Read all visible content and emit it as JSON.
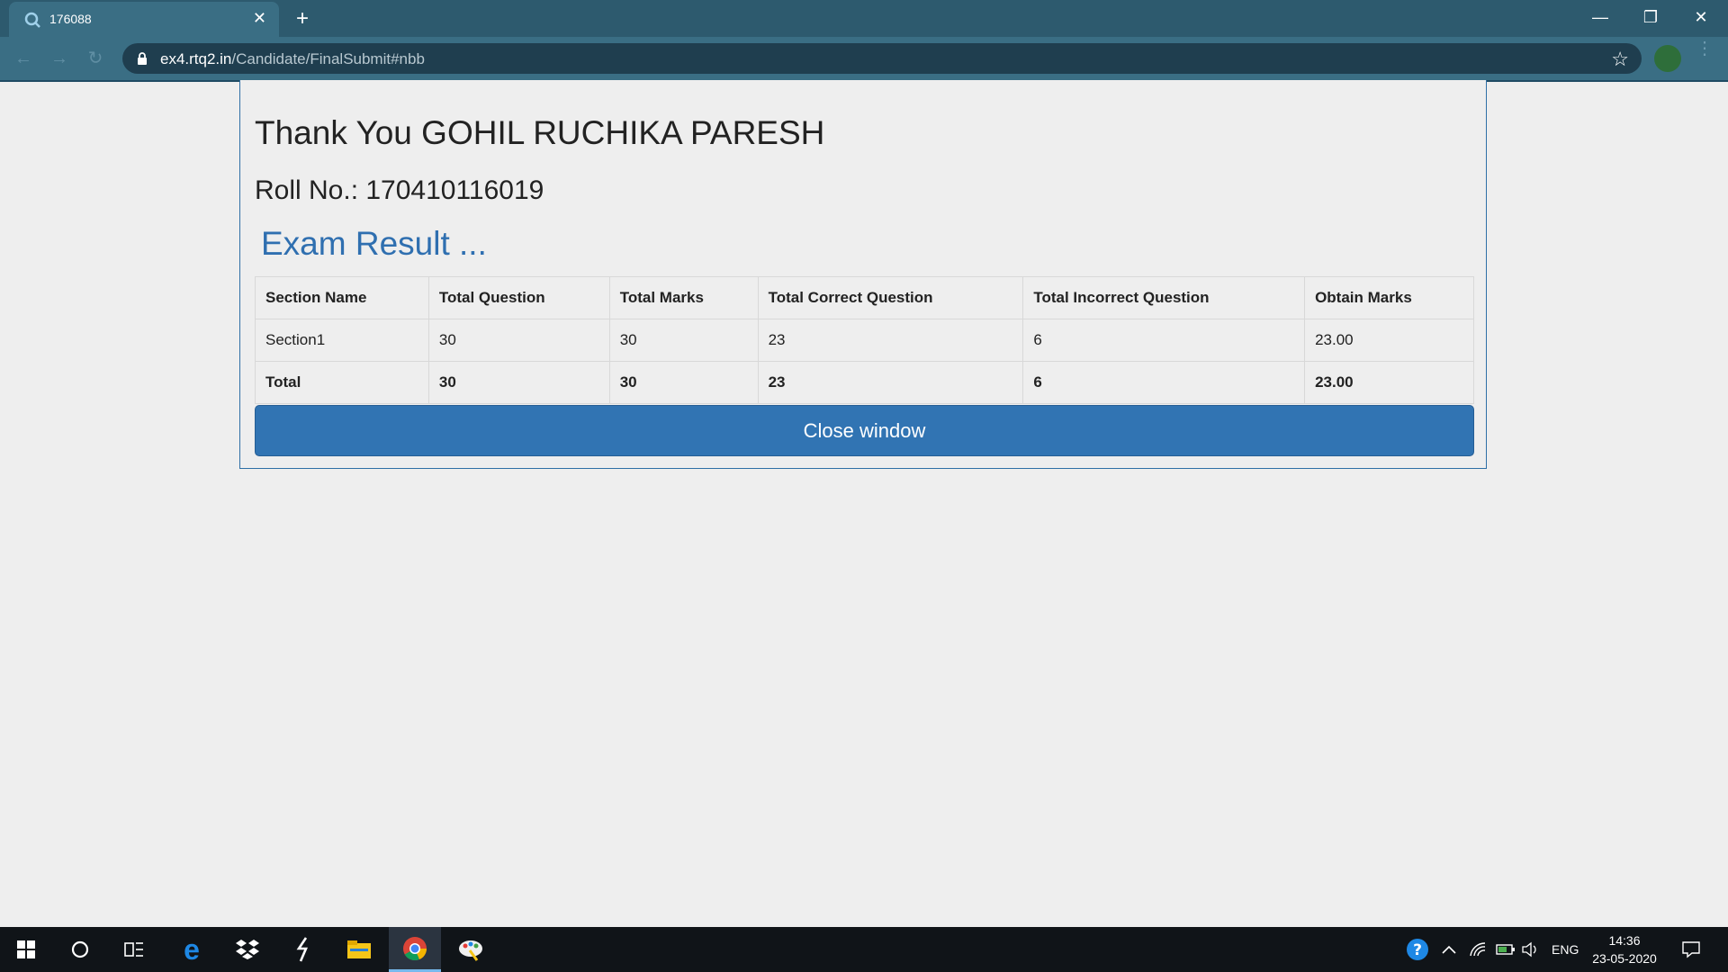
{
  "browser": {
    "tab_title": "176088",
    "tab_close": "✕",
    "new_tab": "+",
    "url_host": "ex4.rtq2.in",
    "url_path": "/Candidate/FinalSubmit#nbb",
    "window_controls": {
      "minimize": "—",
      "restore": "❐",
      "close": "✕"
    }
  },
  "page": {
    "thank_you": "Thank You GOHIL RUCHIKA PARESH",
    "roll_no": "Roll No.: 170410116019",
    "exam_heading": "Exam Result ...",
    "table": {
      "headers": [
        "Section Name",
        "Total Question",
        "Total Marks",
        "Total Correct Question",
        "Total Incorrect Question",
        "Obtain Marks"
      ],
      "rows": [
        [
          "Section1",
          "30",
          "30",
          "23",
          "6",
          "23.00"
        ]
      ],
      "total_row": [
        "Total",
        "30",
        "30",
        "23",
        "6",
        "23.00"
      ]
    },
    "close_button": "Close window"
  },
  "taskbar": {
    "lang": "ENG",
    "time": "14:36",
    "date": "23-05-2020",
    "icons": [
      "windows-start-icon",
      "cortana-icon",
      "task-view-icon",
      "edge-icon",
      "dropbox-icon",
      "sublime-icon",
      "file-explorer-icon",
      "chrome-icon",
      "paint-icon"
    ]
  },
  "colors": {
    "accent": "#3174b3",
    "heading_blue": "#2f6fb0",
    "browser_frame": "#2d5a6e"
  }
}
